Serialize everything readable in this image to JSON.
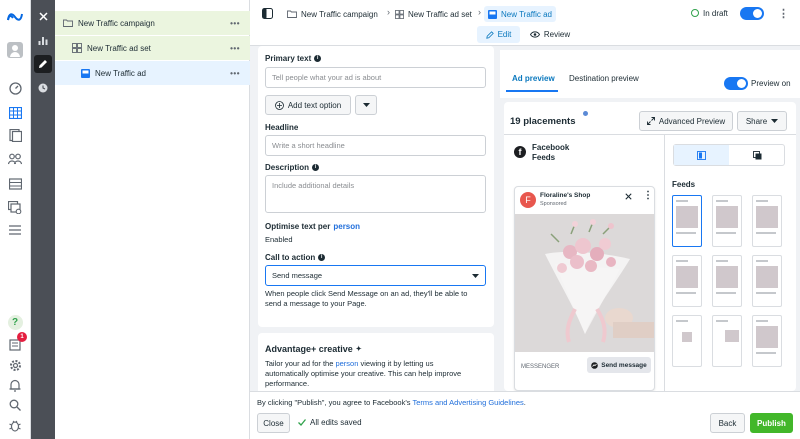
{
  "rail": {
    "icons": [
      "meta-logo-icon",
      "avatar",
      "dashboard-icon",
      "table-icon",
      "pages-icon",
      "audience-icon",
      "catalog-icon",
      "stack-icon",
      "menu-icon",
      "help-icon",
      "notifications-icon",
      "settings-icon",
      "alerts-icon",
      "search-icon",
      "debug-icon"
    ],
    "notification_count": "1"
  },
  "tree": {
    "campaign": "New Traffic campaign",
    "adset": "New Traffic ad set",
    "ad": "New Traffic ad",
    "more": "•••"
  },
  "header": {
    "breadcrumb": [
      "New Traffic campaign",
      "New Traffic ad set",
      "New Traffic ad"
    ],
    "status": "In draft",
    "edit_label": "Edit",
    "review_label": "Review"
  },
  "form": {
    "primary_text": {
      "label": "Primary text",
      "placeholder": "Tell people what your ad is about"
    },
    "add_text_option": "Add text option",
    "headline": {
      "label": "Headline",
      "placeholder": "Write a short headline"
    },
    "description": {
      "label": "Description",
      "placeholder": "Include additional details"
    },
    "optimise": {
      "label_prefix": "Optimise text per",
      "label_link": "person",
      "value": "Enabled"
    },
    "cta": {
      "label": "Call to action",
      "value": "Send message"
    },
    "cta_help": [
      "When people click Send Message on an ad, they'll be able to",
      "send a message to your Page."
    ],
    "advantage": {
      "title": "Advantage+ creative",
      "line1_prefix": "Tailor your ad for the",
      "line1_link": "person",
      "line1_suffix": "viewing it by letting us",
      "line2": "automatically optimise your creative. This can help improve",
      "line3": "performance."
    }
  },
  "preview": {
    "tabs": [
      "Ad preview",
      "Destination preview"
    ],
    "preview_on_label": "Preview on",
    "placements": "19 placements",
    "advanced_preview": "Advanced Preview",
    "share": "Share",
    "facebook": "Facebook",
    "feeds": "Feeds",
    "feeds_header": "Feeds",
    "ad_card": {
      "page_name": "Floraline's Shop",
      "sponsored": "Sponsored",
      "initial": "F",
      "messenger": "MESSENGER",
      "send_message": "Send message"
    }
  },
  "footer": {
    "consent_prefix": "By clicking \"Publish\", you agree to Facebook's",
    "consent_link": "Terms and Advertising Guidelines",
    "consent_suffix": ".",
    "close": "Close",
    "saved": "All edits saved",
    "back": "Back",
    "publish": "Publish"
  },
  "colors": {
    "accent": "#1877f2",
    "publish": "#42b72a",
    "campaign_row": "#ebf5df",
    "ad_row": "#e7f3ff"
  }
}
